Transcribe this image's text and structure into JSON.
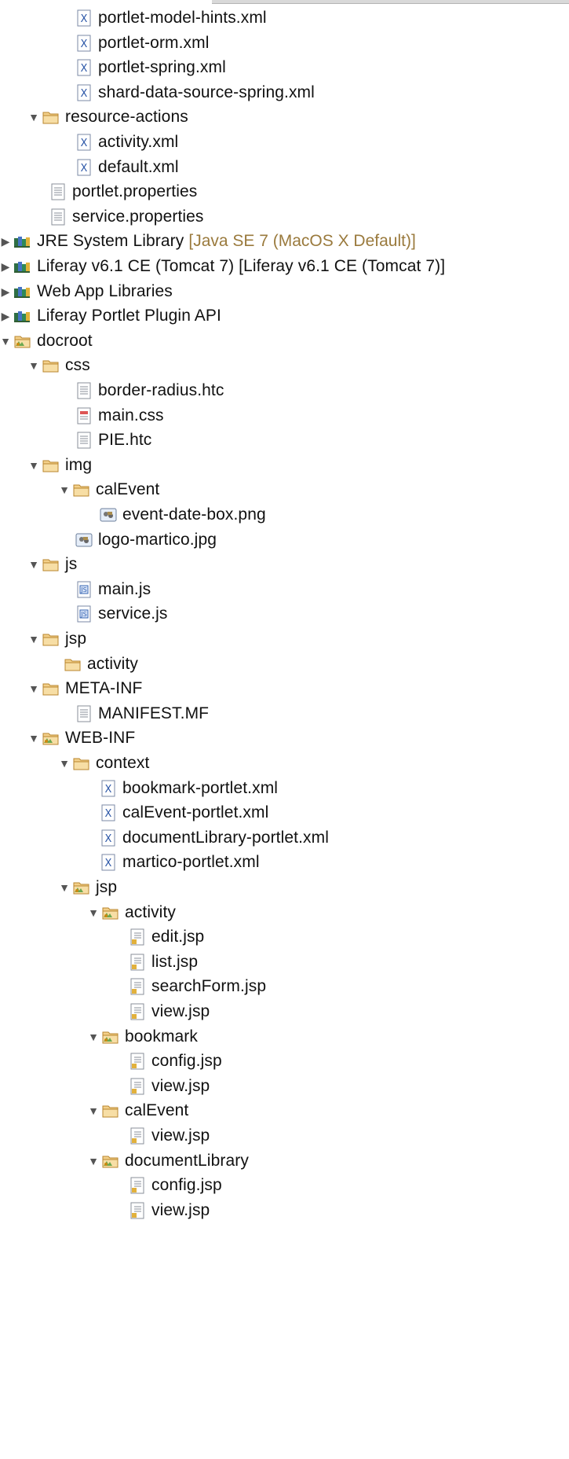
{
  "tree": {
    "items": [
      {
        "label": "portlet-model-hints.xml",
        "icon": "xml-file-icon",
        "indent": 95,
        "expanded": null,
        "decoration": ""
      },
      {
        "label": "portlet-orm.xml",
        "icon": "xml-file-icon",
        "indent": 95,
        "expanded": null,
        "decoration": ""
      },
      {
        "label": "portlet-spring.xml",
        "icon": "xml-file-icon",
        "indent": 95,
        "expanded": null,
        "decoration": ""
      },
      {
        "label": "shard-data-source-spring.xml",
        "icon": "xml-file-icon",
        "indent": 95,
        "expanded": null,
        "decoration": ""
      },
      {
        "label": "resource-actions",
        "icon": "folder-icon",
        "indent": 36,
        "expanded": true,
        "decoration": ""
      },
      {
        "label": "activity.xml",
        "icon": "xml-file-icon",
        "indent": 95,
        "expanded": null,
        "decoration": ""
      },
      {
        "label": "default.xml",
        "icon": "xml-file-icon",
        "indent": 95,
        "expanded": null,
        "decoration": ""
      },
      {
        "label": "portlet.properties",
        "icon": "text-file-icon",
        "indent": 62,
        "expanded": null,
        "decoration": ""
      },
      {
        "label": "service.properties",
        "icon": "text-file-icon",
        "indent": 62,
        "expanded": null,
        "decoration": ""
      },
      {
        "label": "JRE System Library",
        "icon": "library-icon",
        "indent": 0,
        "expanded": false,
        "decoration": "[Java SE 7 (MacOS X Default)]"
      },
      {
        "label": "Liferay v6.1 CE (Tomcat 7) [Liferay v6.1 CE (Tomcat 7)]",
        "icon": "library-icon",
        "indent": 0,
        "expanded": false,
        "decoration": ""
      },
      {
        "label": "Web App Libraries",
        "icon": "library-icon",
        "indent": 0,
        "expanded": false,
        "decoration": ""
      },
      {
        "label": "Liferay Portlet Plugin API",
        "icon": "library-icon",
        "indent": 0,
        "expanded": false,
        "decoration": ""
      },
      {
        "label": "docroot",
        "icon": "web-folder-icon",
        "indent": 0,
        "expanded": true,
        "decoration": ""
      },
      {
        "label": "css",
        "icon": "folder-icon",
        "indent": 36,
        "expanded": true,
        "decoration": ""
      },
      {
        "label": "border-radius.htc",
        "icon": "text-file-icon",
        "indent": 95,
        "expanded": null,
        "decoration": ""
      },
      {
        "label": "main.css",
        "icon": "css-file-icon",
        "indent": 95,
        "expanded": null,
        "decoration": ""
      },
      {
        "label": "PIE.htc",
        "icon": "text-file-icon",
        "indent": 95,
        "expanded": null,
        "decoration": ""
      },
      {
        "label": "img",
        "icon": "folder-icon",
        "indent": 36,
        "expanded": true,
        "decoration": ""
      },
      {
        "label": "calEvent",
        "icon": "folder-icon",
        "indent": 75,
        "expanded": true,
        "decoration": ""
      },
      {
        "label": "event-date-box.png",
        "icon": "image-file-icon",
        "indent": 126,
        "expanded": null,
        "decoration": ""
      },
      {
        "label": "logo-martico.jpg",
        "icon": "image-file-icon",
        "indent": 95,
        "expanded": null,
        "decoration": ""
      },
      {
        "label": "js",
        "icon": "folder-icon",
        "indent": 36,
        "expanded": true,
        "decoration": ""
      },
      {
        "label": "main.js",
        "icon": "js-file-icon",
        "indent": 95,
        "expanded": null,
        "decoration": ""
      },
      {
        "label": "service.js",
        "icon": "js-file-icon",
        "indent": 95,
        "expanded": null,
        "decoration": ""
      },
      {
        "label": "jsp",
        "icon": "folder-icon",
        "indent": 36,
        "expanded": true,
        "decoration": ""
      },
      {
        "label": "activity",
        "icon": "folder-icon",
        "indent": 81,
        "expanded": null,
        "decoration": ""
      },
      {
        "label": "META-INF",
        "icon": "folder-icon",
        "indent": 36,
        "expanded": true,
        "decoration": ""
      },
      {
        "label": "MANIFEST.MF",
        "icon": "text-file-icon",
        "indent": 95,
        "expanded": null,
        "decoration": ""
      },
      {
        "label": "WEB-INF",
        "icon": "web-folder-icon",
        "indent": 36,
        "expanded": true,
        "decoration": ""
      },
      {
        "label": "context",
        "icon": "folder-icon",
        "indent": 75,
        "expanded": true,
        "decoration": ""
      },
      {
        "label": "bookmark-portlet.xml",
        "icon": "xml-file-icon",
        "indent": 126,
        "expanded": null,
        "decoration": ""
      },
      {
        "label": "calEvent-portlet.xml",
        "icon": "xml-file-icon",
        "indent": 126,
        "expanded": null,
        "decoration": ""
      },
      {
        "label": "documentLibrary-portlet.xml",
        "icon": "xml-file-icon",
        "indent": 126,
        "expanded": null,
        "decoration": ""
      },
      {
        "label": "martico-portlet.xml",
        "icon": "xml-file-icon",
        "indent": 126,
        "expanded": null,
        "decoration": ""
      },
      {
        "label": "jsp",
        "icon": "web-folder-icon",
        "indent": 75,
        "expanded": true,
        "decoration": ""
      },
      {
        "label": "activity",
        "icon": "web-folder-icon",
        "indent": 112,
        "expanded": true,
        "decoration": ""
      },
      {
        "label": "edit.jsp",
        "icon": "jsp-file-icon",
        "indent": 163,
        "expanded": null,
        "decoration": ""
      },
      {
        "label": "list.jsp",
        "icon": "jsp-file-icon",
        "indent": 163,
        "expanded": null,
        "decoration": ""
      },
      {
        "label": "searchForm.jsp",
        "icon": "jsp-file-icon",
        "indent": 163,
        "expanded": null,
        "decoration": ""
      },
      {
        "label": "view.jsp",
        "icon": "jsp-file-icon",
        "indent": 163,
        "expanded": null,
        "decoration": ""
      },
      {
        "label": "bookmark",
        "icon": "web-folder-icon",
        "indent": 112,
        "expanded": true,
        "decoration": ""
      },
      {
        "label": "config.jsp",
        "icon": "jsp-file-icon",
        "indent": 163,
        "expanded": null,
        "decoration": ""
      },
      {
        "label": "view.jsp",
        "icon": "jsp-file-icon",
        "indent": 163,
        "expanded": null,
        "decoration": ""
      },
      {
        "label": "calEvent",
        "icon": "folder-icon",
        "indent": 112,
        "expanded": true,
        "decoration": ""
      },
      {
        "label": "view.jsp",
        "icon": "jsp-file-icon",
        "indent": 163,
        "expanded": null,
        "decoration": ""
      },
      {
        "label": "documentLibrary",
        "icon": "web-folder-icon",
        "indent": 112,
        "expanded": true,
        "decoration": ""
      },
      {
        "label": "config.jsp",
        "icon": "jsp-file-icon",
        "indent": 163,
        "expanded": null,
        "decoration": ""
      },
      {
        "label": "view.jsp",
        "icon": "jsp-file-icon",
        "indent": 163,
        "expanded": null,
        "decoration": ""
      }
    ]
  },
  "colors": {
    "decoration": "#9a7a3d",
    "folder": "#e8b866",
    "xml": "#3a67b3"
  }
}
